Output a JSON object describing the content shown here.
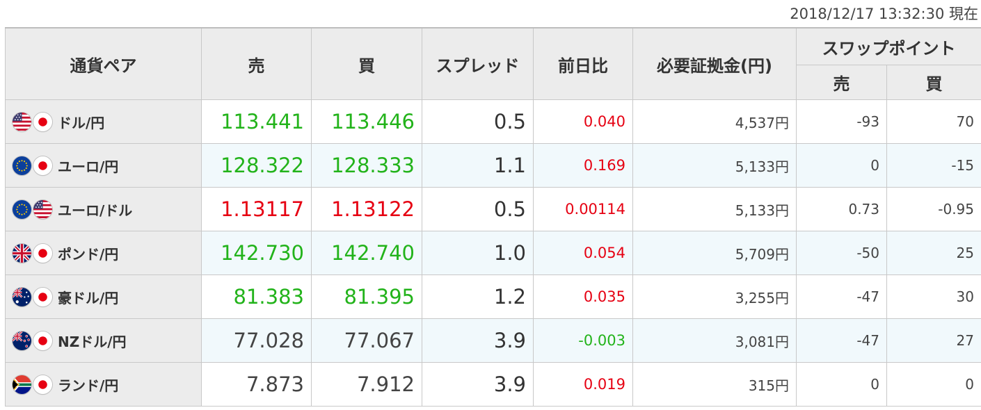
{
  "timestamp": "2018/12/17 13:32:30 現在",
  "headers": {
    "pair": "通貨ペア",
    "sell": "売",
    "buy": "買",
    "spread": "スプレッド",
    "change": "前日比",
    "margin": "必要証拠金(円)",
    "swap": "スワップポイント",
    "swap_sell": "売",
    "swap_buy": "買"
  },
  "colors": {
    "up": "#22b31a",
    "down": "#e60012",
    "neutral": "#444444"
  },
  "rows": [
    {
      "flag1": "us-flag-icon",
      "flag2": "jp-flag-icon",
      "pair": "ドル/円",
      "sell": "113.441",
      "buy": "113.446",
      "spread": "0.5",
      "change": "0.040",
      "margin": "4,537円",
      "swap_sell": "-93",
      "swap_buy": "70",
      "price_color": "up",
      "change_color": "down"
    },
    {
      "flag1": "eu-flag-icon",
      "flag2": "jp-flag-icon",
      "pair": "ユーロ/円",
      "sell": "128.322",
      "buy": "128.333",
      "spread": "1.1",
      "change": "0.169",
      "margin": "5,133円",
      "swap_sell": "0",
      "swap_buy": "-15",
      "price_color": "up",
      "change_color": "down"
    },
    {
      "flag1": "eu-flag-icon",
      "flag2": "us-flag-icon",
      "pair": "ユーロ/ドル",
      "sell": "1.13117",
      "buy": "1.13122",
      "spread": "0.5",
      "change": "0.00114",
      "margin": "5,133円",
      "swap_sell": "0.73",
      "swap_buy": "-0.95",
      "price_color": "down",
      "change_color": "down"
    },
    {
      "flag1": "uk-flag-icon",
      "flag2": "jp-flag-icon",
      "pair": "ポンド/円",
      "sell": "142.730",
      "buy": "142.740",
      "spread": "1.0",
      "change": "0.054",
      "margin": "5,709円",
      "swap_sell": "-50",
      "swap_buy": "25",
      "price_color": "up",
      "change_color": "down"
    },
    {
      "flag1": "au-flag-icon",
      "flag2": "jp-flag-icon",
      "pair": "豪ドル/円",
      "sell": "81.383",
      "buy": "81.395",
      "spread": "1.2",
      "change": "0.035",
      "margin": "3,255円",
      "swap_sell": "-47",
      "swap_buy": "30",
      "price_color": "up",
      "change_color": "down"
    },
    {
      "flag1": "nz-flag-icon",
      "flag2": "jp-flag-icon",
      "pair": "NZドル/円",
      "sell": "77.028",
      "buy": "77.067",
      "spread": "3.9",
      "change": "-0.003",
      "margin": "3,081円",
      "swap_sell": "-47",
      "swap_buy": "27",
      "price_color": "neutral",
      "change_color": "up"
    },
    {
      "flag1": "za-flag-icon",
      "flag2": "jp-flag-icon",
      "pair": "ランド/円",
      "sell": "7.873",
      "buy": "7.912",
      "spread": "3.9",
      "change": "0.019",
      "margin": "315円",
      "swap_sell": "0",
      "swap_buy": "0",
      "price_color": "neutral",
      "change_color": "down"
    }
  ]
}
